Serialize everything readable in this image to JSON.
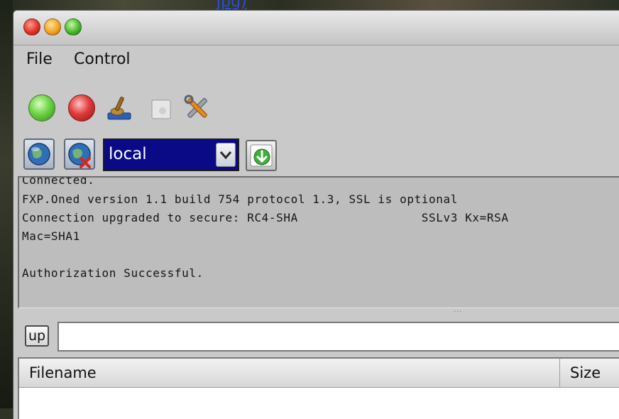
{
  "background": {
    "link_text": "jpg)"
  },
  "menu": {
    "file": "File",
    "control": "Control"
  },
  "toolbar": {
    "start_icon": "green-circle-icon",
    "stop_icon": "red-circle-icon",
    "clean_icon": "broom-icon",
    "blank_icon": "blank-icon",
    "settings_icon": "tools-icon"
  },
  "connection": {
    "site": "local",
    "connect_icon": "globe-icon",
    "disconnect_icon": "globe-x-icon",
    "transfer_icon": "download-icon"
  },
  "log": {
    "lines": [
      "Connected.",
      "FXP.Oned version 1.1 build 754 protocol 1.3, SSL is optional",
      "Connection upgraded to secure: RC4-SHA                 SSLv3 Kx=RSA",
      "Mac=SHA1",
      "",
      "Authorization Successful."
    ]
  },
  "path": {
    "up_label": "up",
    "value": ""
  },
  "files": {
    "columns": [
      "Filename",
      "Size"
    ]
  },
  "colors": {
    "window_bg": "#c9c9c9",
    "select_bg": "#0a0a87",
    "close": "#e0332a",
    "minimize": "#f1a322",
    "maximize": "#46b92c"
  }
}
